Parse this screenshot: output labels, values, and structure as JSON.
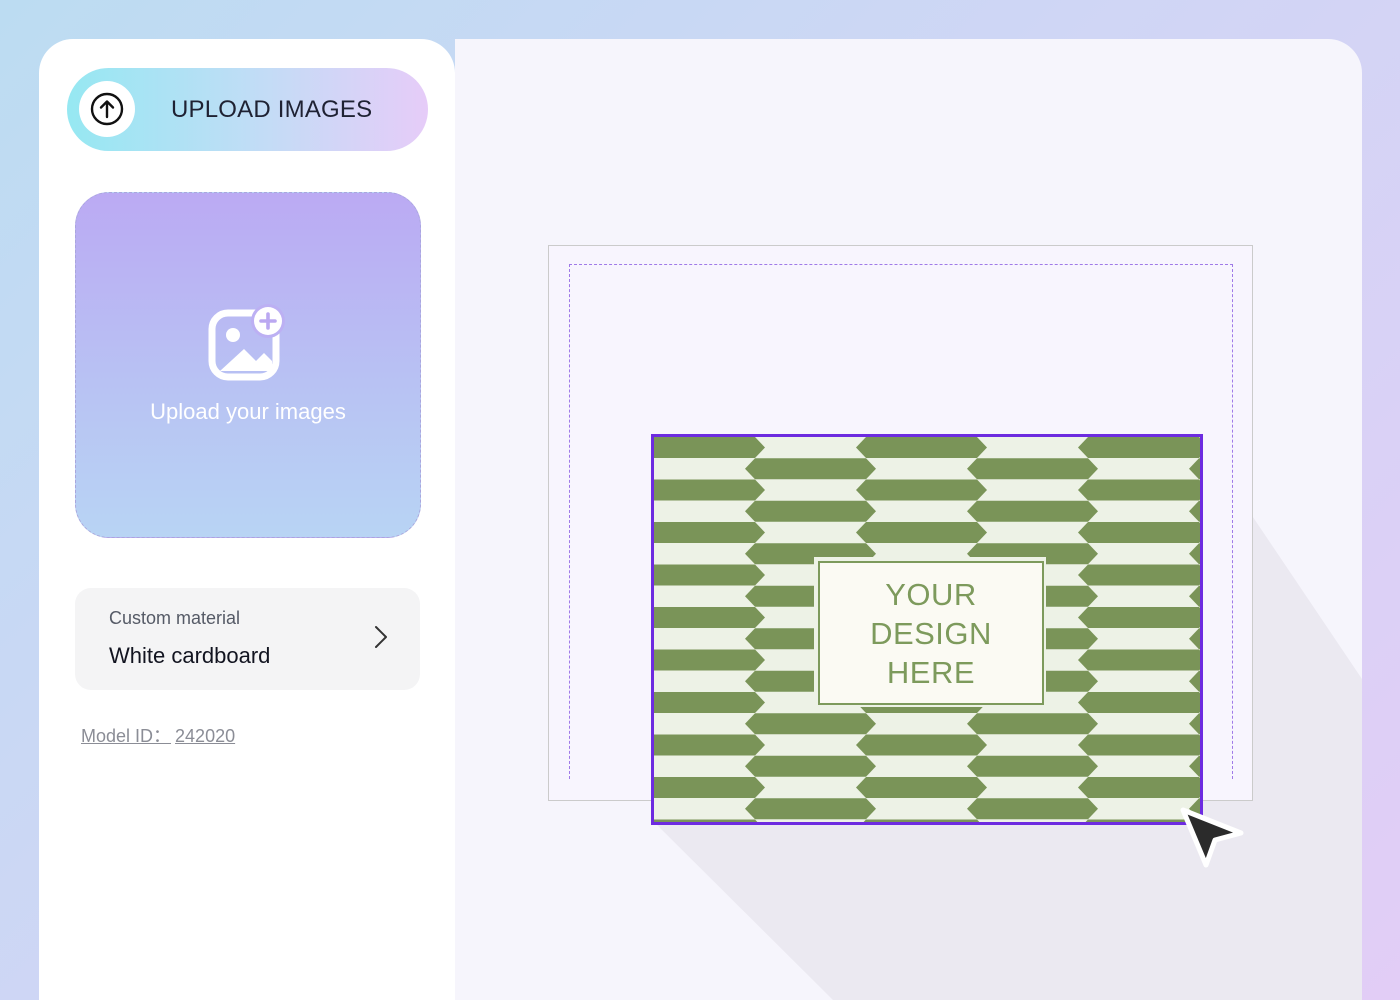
{
  "sidebar": {
    "upload_button": {
      "label": "UPLOAD IMAGES",
      "icon": "arrow-up-circle-icon"
    },
    "drop_zone": {
      "label": "Upload your images",
      "icon": "add-image-icon"
    },
    "material": {
      "caption": "Custom material",
      "value": "White cardboard"
    },
    "model_id": {
      "label": "Model ID：",
      "value": "242020"
    }
  },
  "canvas": {
    "design_placeholder": "YOUR\nDESIGN\nHERE",
    "pattern_colors": {
      "dark": "#7a9458",
      "light": "#edf2e6"
    },
    "selection_color": "#6d2be0",
    "cursor_icon": "pointer-arrow-icon"
  }
}
